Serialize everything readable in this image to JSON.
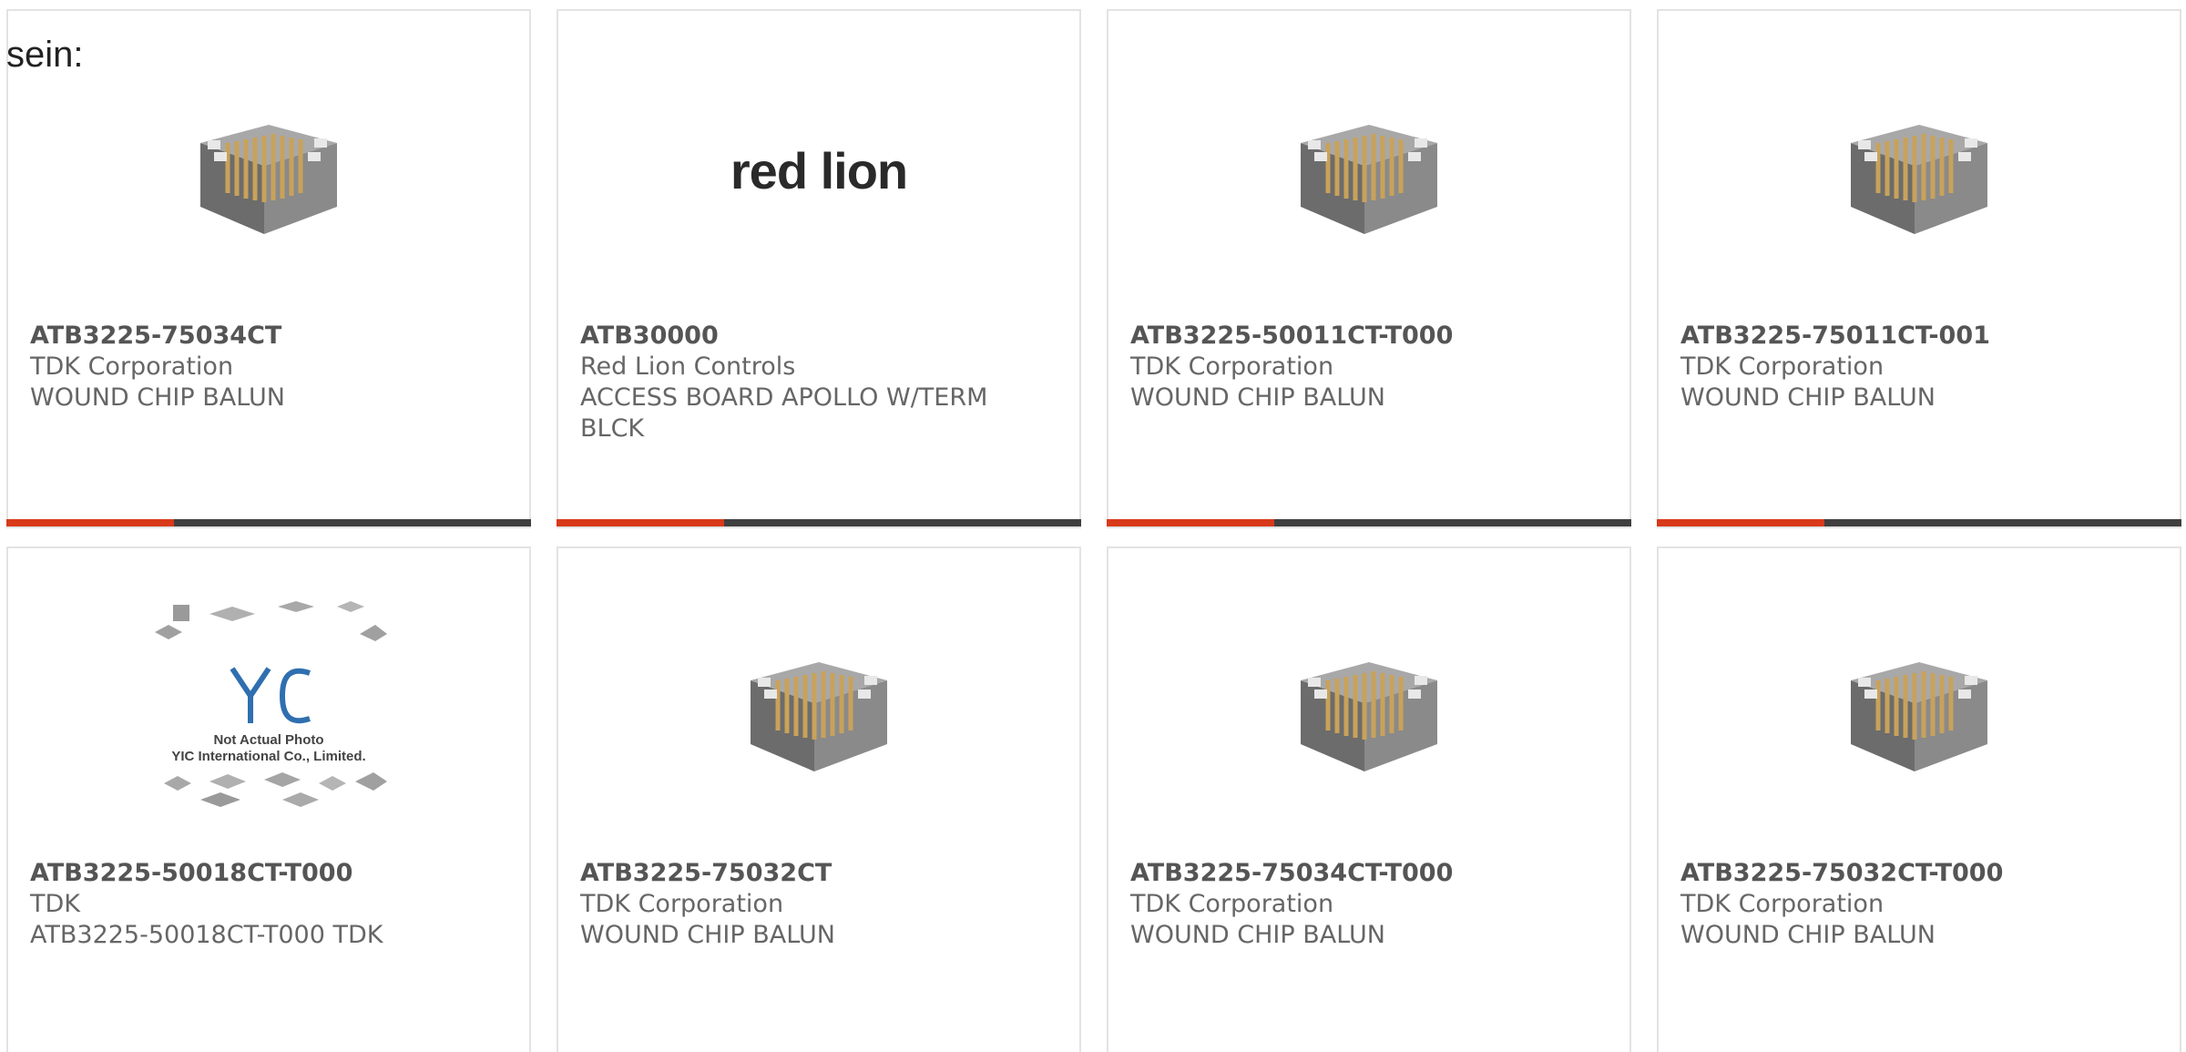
{
  "heading_fragment": "sein:",
  "accent_colors": {
    "progress_fill": "#d83a1a",
    "progress_track": "#3f3f3f",
    "card_border": "#e3e3e3"
  },
  "progress_fraction": 0.32,
  "products": [
    {
      "part_number": "ATB3225-75034CT",
      "manufacturer": "TDK Corporation",
      "description": "WOUND CHIP BALUN",
      "image": "wound-chip-balun-icon"
    },
    {
      "part_number": "ATB30000",
      "manufacturer": "Red Lion Controls",
      "description": "ACCESS BOARD APOLLO W/TERM BLCK",
      "image": "red-lion-logo",
      "logo_text": "red lion"
    },
    {
      "part_number": "ATB3225-50011CT-T000",
      "manufacturer": "TDK Corporation",
      "description": "WOUND CHIP BALUN",
      "image": "wound-chip-balun-icon"
    },
    {
      "part_number": "ATB3225-75011CT-001",
      "manufacturer": "TDK Corporation",
      "description": "WOUND CHIP BALUN",
      "image": "wound-chip-balun-icon"
    },
    {
      "part_number": "ATB3225-50018CT-T000",
      "manufacturer": "TDK",
      "description": "ATB3225-50018CT-T000 TDK",
      "image": "yic-not-actual-photo",
      "placeholder_lines": [
        "Not Actual Photo",
        "YIC International Co., Limited."
      ]
    },
    {
      "part_number": "ATB3225-75032CT",
      "manufacturer": "TDK Corporation",
      "description": "WOUND CHIP BALUN",
      "image": "wound-chip-balun-icon"
    },
    {
      "part_number": "ATB3225-75034CT-T000",
      "manufacturer": "TDK Corporation",
      "description": "WOUND CHIP BALUN",
      "image": "wound-chip-balun-icon"
    },
    {
      "part_number": "ATB3225-75032CT-T000",
      "manufacturer": "TDK Corporation",
      "description": "WOUND CHIP BALUN",
      "image": "wound-chip-balun-icon"
    }
  ]
}
